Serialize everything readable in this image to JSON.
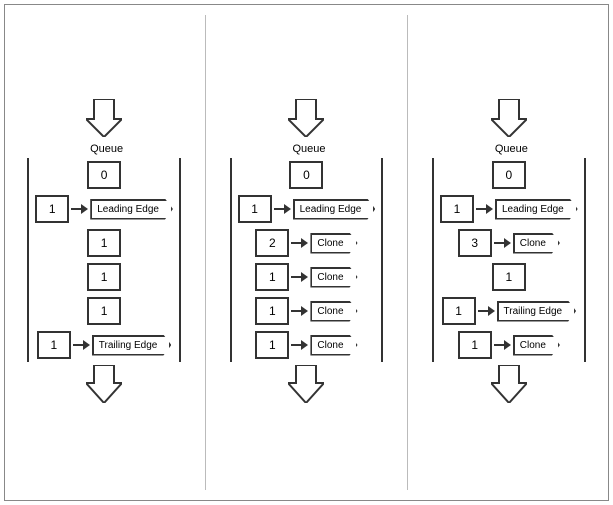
{
  "diagrams": [
    {
      "id": "diagram-1",
      "label": "Queue",
      "cells": [
        {
          "value": "0",
          "label": null
        },
        {
          "value": "1",
          "label": "Leading Edge"
        },
        {
          "value": "1",
          "label": null
        },
        {
          "value": "1",
          "label": null
        },
        {
          "value": "1",
          "label": null
        },
        {
          "value": "1",
          "label": "Trailing Edge"
        }
      ]
    },
    {
      "id": "diagram-2",
      "label": "Queue",
      "cells": [
        {
          "value": "0",
          "label": null
        },
        {
          "value": "1",
          "label": "Leading Edge"
        },
        {
          "value": "2",
          "label": "Clone"
        },
        {
          "value": "1",
          "label": "Clone"
        },
        {
          "value": "1",
          "label": "Clone"
        },
        {
          "value": "1",
          "label": "Clone"
        }
      ]
    },
    {
      "id": "diagram-3",
      "label": "Queue",
      "cells": [
        {
          "value": "0",
          "label": null
        },
        {
          "value": "1",
          "label": "Leading Edge"
        },
        {
          "value": "3",
          "label": "Clone"
        },
        {
          "value": "1",
          "label": null
        },
        {
          "value": "1",
          "label": "Trailing Edge"
        },
        {
          "value": "1",
          "label": "Clone"
        }
      ]
    }
  ]
}
